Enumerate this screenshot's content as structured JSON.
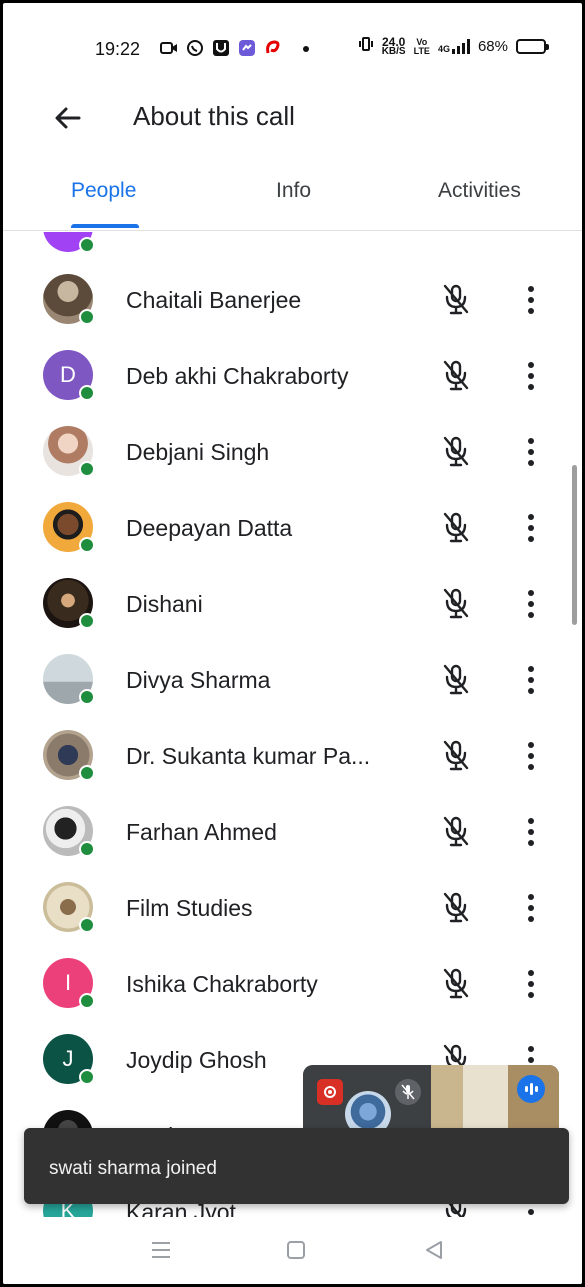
{
  "status_bar": {
    "time": "19:22",
    "network_speed_value": "24.0",
    "network_speed_unit": "KB/S",
    "volte_top": "Vo",
    "volte_bottom": "LTE",
    "signal_label": "4G",
    "battery_percent": "68%",
    "battery_level": 0.68
  },
  "app_bar": {
    "title": "About this call"
  },
  "tabs": [
    {
      "label": "People",
      "active": true
    },
    {
      "label": "Info",
      "active": false
    },
    {
      "label": "Activities",
      "active": false
    }
  ],
  "participants": [
    {
      "name": "Chaitali Banerjee",
      "initial": "",
      "avatar_color": "",
      "photo": "photo-a"
    },
    {
      "name": "Deb akhi Chakraborty",
      "initial": "D",
      "avatar_color": "#7e57c2",
      "photo": ""
    },
    {
      "name": "Debjani Singh",
      "initial": "",
      "avatar_color": "",
      "photo": "photo-b"
    },
    {
      "name": "Deepayan Datta",
      "initial": "",
      "avatar_color": "",
      "photo": "photo-c"
    },
    {
      "name": "Dishani",
      "initial": "",
      "avatar_color": "",
      "photo": "photo-d"
    },
    {
      "name": "Divya Sharma",
      "initial": "",
      "avatar_color": "",
      "photo": "photo-e"
    },
    {
      "name": "Dr. Sukanta kumar Pa...",
      "initial": "",
      "avatar_color": "",
      "photo": "photo-f"
    },
    {
      "name": "Farhan Ahmed",
      "initial": "",
      "avatar_color": "",
      "photo": "photo-g"
    },
    {
      "name": "Film Studies",
      "initial": "",
      "avatar_color": "",
      "photo": "photo-h"
    },
    {
      "name": "Ishika Chakraborty",
      "initial": "I",
      "avatar_color": "#ec407a",
      "photo": ""
    },
    {
      "name": "Joydip Ghosh",
      "initial": "J",
      "avatar_color": "#0b5345",
      "photo": ""
    },
    {
      "name": "Jyotirmoy T...",
      "initial": "",
      "avatar_color": "",
      "photo": "photo-i"
    },
    {
      "name": "Karan Jyot",
      "initial": "K",
      "avatar_color": "#26a69a",
      "photo": ""
    }
  ],
  "snackbar": {
    "message": "swati sharma joined"
  },
  "colors": {
    "accent": "#1a73e8",
    "online": "#1e8e3e",
    "snackbar_bg": "#323232"
  }
}
